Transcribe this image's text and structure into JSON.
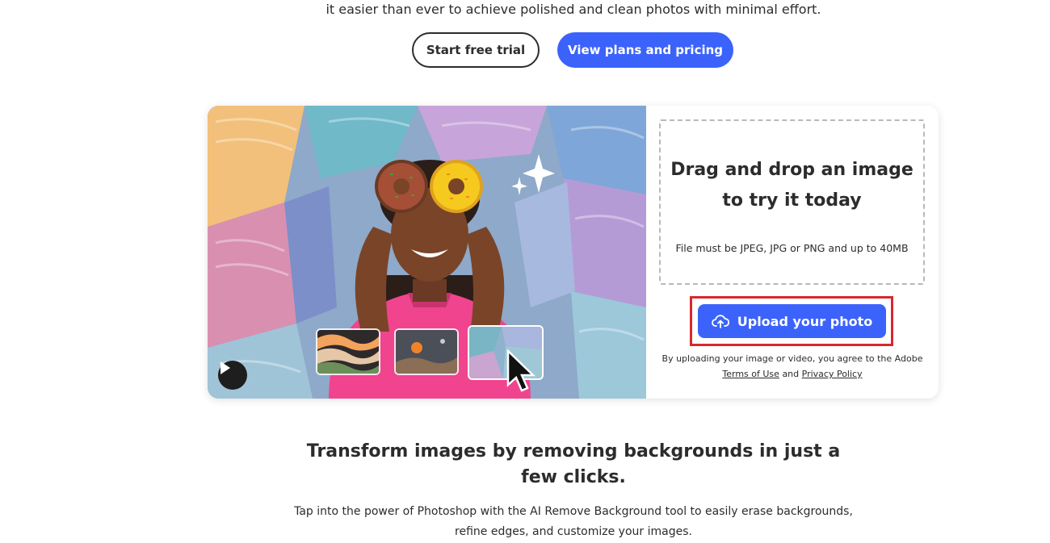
{
  "intro": {
    "line": "it easier than ever to achieve polished and clean photos with minimal effort."
  },
  "cta": {
    "trial_label": "Start free trial",
    "pricing_label": "View plans and pricing"
  },
  "upload_panel": {
    "drop_title_line1": "Drag and drop an image",
    "drop_title_line2": "to try it today",
    "file_note": "File must be JPEG, JPG or PNG and up to 40MB",
    "upload_label": "Upload your photo",
    "legal_prefix": "By uploading your image or video, you agree to the Adobe",
    "terms_label": "Terms of Use",
    "legal_and": "and",
    "privacy_label": "Privacy Policy"
  },
  "section": {
    "title": "Transform images by removing backgrounds in just a few clicks.",
    "description": "Tap into the power of Photoshop with the AI Remove Background tool to easily erase backgrounds, refine edges, and customize your images."
  },
  "icons": {
    "play": "play-icon",
    "upload": "cloud-upload-icon",
    "sparkle": "sparkle-icon",
    "cursor": "mouse-pointer-icon"
  },
  "colors": {
    "accent": "#3b63fb",
    "highlight": "#d8282c",
    "text": "#2c2c2c",
    "shirt": "#f0448f"
  }
}
